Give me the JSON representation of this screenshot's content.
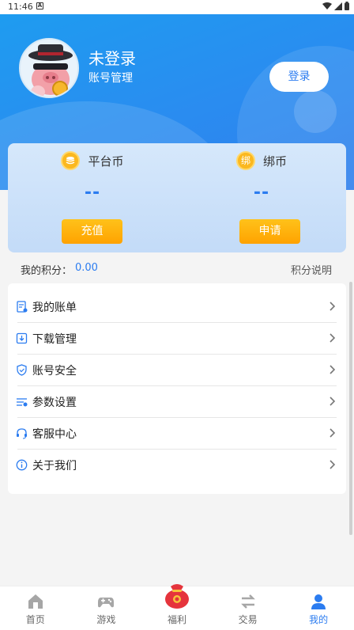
{
  "status_bar": {
    "time": "11:46",
    "notif": "A"
  },
  "profile": {
    "username": "未登录",
    "subtitle": "账号管理",
    "login_label": "登录"
  },
  "wallet": {
    "platform_coin": {
      "label": "平台币",
      "value": "--",
      "button": "充值",
      "icon_text": ""
    },
    "bound_coin": {
      "label": "绑币",
      "value": "--",
      "button": "申请",
      "icon_text": "绑"
    }
  },
  "points": {
    "label": "我的积分：",
    "value": "0.00",
    "help": "积分说明"
  },
  "menu": {
    "items": [
      {
        "label": "我的账单",
        "icon": "bill-icon"
      },
      {
        "label": "下载管理",
        "icon": "download-icon"
      },
      {
        "label": "账号安全",
        "icon": "shield-icon"
      },
      {
        "label": "参数设置",
        "icon": "settings-icon"
      },
      {
        "label": "客服中心",
        "icon": "headset-icon"
      },
      {
        "label": "关于我们",
        "icon": "info-icon"
      }
    ]
  },
  "tabbar": {
    "tabs": [
      {
        "label": "首页",
        "icon": "home-icon"
      },
      {
        "label": "游戏",
        "icon": "gamepad-icon"
      },
      {
        "label": "福利",
        "icon": "lucky-bag-icon"
      },
      {
        "label": "交易",
        "icon": "swap-icon"
      },
      {
        "label": "我的",
        "icon": "user-icon"
      }
    ],
    "active_index": 4
  },
  "colors": {
    "accent": "#2b7cf0",
    "button_gold": "#ffb000",
    "header_blue": "#1e9cf0"
  }
}
